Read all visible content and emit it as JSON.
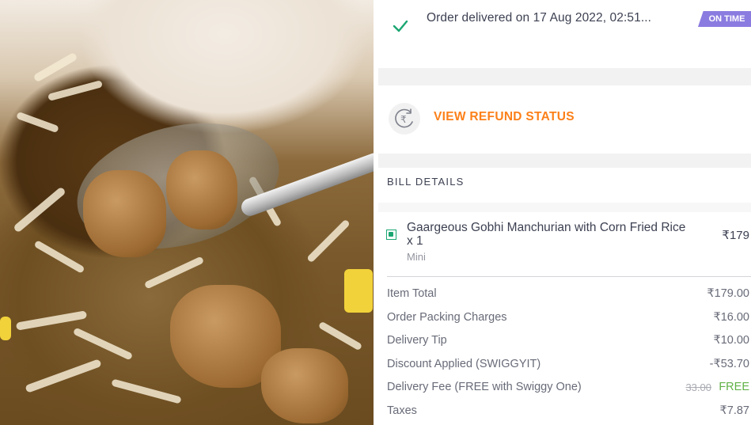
{
  "photo": {
    "alt": "Fried rice with Gobhi Manchurian and a spoon"
  },
  "order": {
    "status_text": "Order delivered on 17 Aug 2022, 02:51...",
    "badge": "ON TIME",
    "check_icon": "check-icon"
  },
  "refund": {
    "link_label": "VIEW REFUND STATUS",
    "icon": "rupee-refund-icon"
  },
  "bill": {
    "title": "BILL DETAILS",
    "item": {
      "name": "Gaargeous Gobhi Manchurian with Corn Fried Rice x 1",
      "variant": "Mini",
      "price": "₹179"
    },
    "rows": [
      {
        "label": "Item Total",
        "value": "₹179.00"
      },
      {
        "label": "Order Packing Charges",
        "value": "₹16.00"
      },
      {
        "label": "Delivery Tip",
        "value": "₹10.00"
      },
      {
        "label": "Discount Applied (SWIGGYIT)",
        "value": "-₹53.70"
      },
      {
        "label": "Delivery Fee (FREE with Swiggy One)",
        "strike": "33.00",
        "value": "FREE"
      },
      {
        "label": "Taxes",
        "value": "₹7.87"
      }
    ]
  },
  "colors": {
    "accent": "#fc8019",
    "badge": "#8a7be0",
    "veg": "#1ba672",
    "free": "#60b246"
  }
}
